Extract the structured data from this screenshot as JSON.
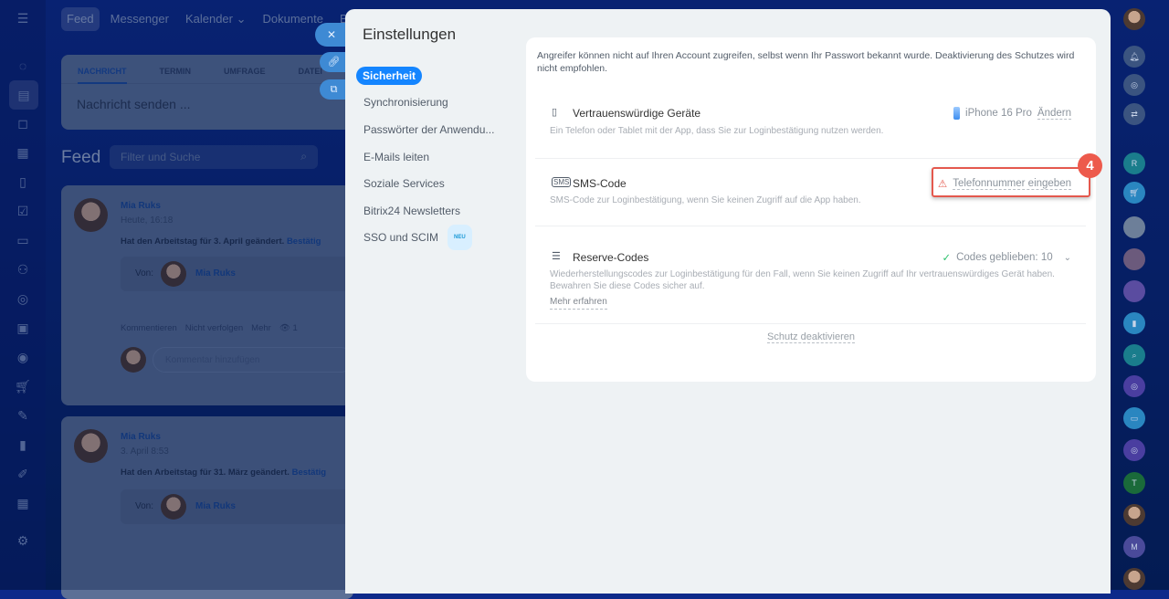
{
  "topnav": {
    "items": [
      "Feed",
      "Messenger",
      "Kalender ⌄",
      "Dokumente",
      "Boa"
    ]
  },
  "compose": {
    "tabs": [
      "NACHRICHT",
      "TERMIN",
      "UMFRAGE",
      "DATEI"
    ],
    "placeholder": "Nachricht senden ..."
  },
  "feed": {
    "title": "Feed",
    "filter_placeholder": "Filter und Suche",
    "posts": [
      {
        "author": "Mia Ruks",
        "date": "Heute, 16:18",
        "text": "Hat den Arbeitstag für 3. April geändert.",
        "link": "Bestätig",
        "from_label": "Von:",
        "from_name": "Mia Ruks",
        "actions": [
          "Kommentieren",
          "Nicht verfolgen",
          "Mehr"
        ],
        "views": "1",
        "comment_placeholder": "Kommentar hinzufügen"
      },
      {
        "author": "Mia Ruks",
        "date": "3. April 8:53",
        "text": "Hat den Arbeitstag für 31. März geändert.",
        "link": "Bestätig",
        "from_label": "Von:",
        "from_name": "Mia Ruks"
      }
    ]
  },
  "settings": {
    "title": "Einstellungen",
    "menu": [
      {
        "label": "Sicherheit",
        "selected": true
      },
      {
        "label": "Synchronisierung"
      },
      {
        "label": "Passwörter der Anwendu..."
      },
      {
        "label": "E-Mails leiten"
      },
      {
        "label": "Soziale Services"
      },
      {
        "label": "Bitrix24 Newsletters"
      },
      {
        "label": "SSO und SCIM",
        "badge": "NEU"
      }
    ],
    "description": "Angreifer können nicht auf Ihren Account zugreifen, selbst wenn Ihr Passwort bekannt wurde. Deaktivierung des Schutzes wird nicht empfohlen.",
    "rows": [
      {
        "title": "Vertrauenswürdige Geräte",
        "desc": "Ein Telefon oder Tablet mit der App, dass Sie zur Loginbestätigung nutzen werden.",
        "device": "iPhone 16 Pro",
        "action": "Ändern"
      },
      {
        "title": "SMS-Code",
        "desc": "SMS-Code zur Loginbestätigung, wenn Sie keinen Zugriff auf die App haben.",
        "action": "Telefonnummer eingeben"
      },
      {
        "title": "Reserve-Codes",
        "desc": "Wiederherstellungscodes zur Loginbestätigung für den Fall, wenn Sie keinen Zugriff auf Ihr vertrauenswürdiges Gerät haben. Bewahren Sie diese Codes sicher auf.",
        "status": "Codes geblieben: 10",
        "more": "Mehr erfahren"
      }
    ],
    "deactivate": "Schutz deaktivieren"
  },
  "step_badge": "4",
  "rightbar": {
    "letters": [
      "R",
      "T",
      "M"
    ]
  },
  "colors": {
    "accent": "#1485ff",
    "highlight": "#e4584d",
    "success": "#2fc26e",
    "warning": "#e4584d"
  }
}
